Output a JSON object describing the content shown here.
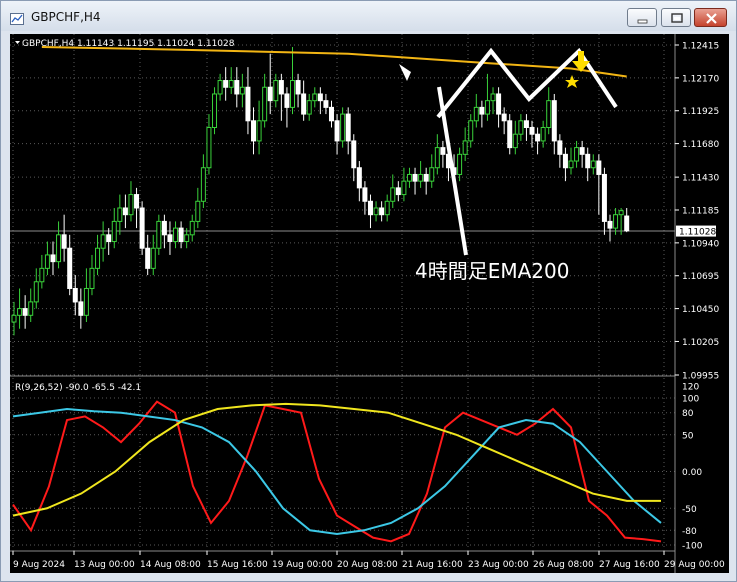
{
  "window": {
    "title": "GBPCHF,H4"
  },
  "main_panel": {
    "info_line": "GBPCHF,H4  1.11143 1.11195 1.11024 1.11028",
    "current_price": "1.11028",
    "price_ticks": [
      "1.12415",
      "1.12170",
      "1.11925",
      "1.11680",
      "1.11430",
      "1.11185",
      "1.10940",
      "1.10695",
      "1.10450",
      "1.10205",
      "1.09955"
    ],
    "annotation": "4時間足EMA200",
    "colors": {
      "ema": "#f2b514",
      "bull": "#39d23a",
      "bear": "#ffffff",
      "marker": "#ffdd00"
    }
  },
  "sub_panel": {
    "label": "R(9,26,52) -90.0 -65.5 -42.1",
    "ticks": [
      "120",
      "100",
      "80",
      "50",
      "0.00",
      "-50",
      "-80",
      "-100"
    ],
    "colors": {
      "r9": "#ff1a1a",
      "r26": "#3cc8e6",
      "r52": "#f0e61e"
    }
  },
  "date_axis": [
    "9 Aug 2024",
    "13 Aug 00:00",
    "14 Aug 08:00",
    "15 Aug 16:00",
    "19 Aug 00:00",
    "20 Aug 08:00",
    "21 Aug 16:00",
    "23 Aug 00:00",
    "26 Aug 08:00",
    "27 Aug 16:00",
    "29 Aug 00:00"
  ],
  "candles": [
    [
      1.1035,
      1.104,
      1.1025,
      1.105
    ],
    [
      1.104,
      1.1045,
      1.103,
      1.106
    ],
    [
      1.1045,
      1.104,
      1.103,
      1.1055
    ],
    [
      1.104,
      1.105,
      1.1035,
      1.106
    ],
    [
      1.105,
      1.1065,
      1.1045,
      1.1075
    ],
    [
      1.1065,
      1.1075,
      1.106,
      1.1085
    ],
    [
      1.1075,
      1.1085,
      1.107,
      1.1095
    ],
    [
      1.1085,
      1.108,
      1.107,
      1.1095
    ],
    [
      1.108,
      1.11,
      1.1075,
      1.111
    ],
    [
      1.11,
      1.109,
      1.108,
      1.1115
    ],
    [
      1.109,
      1.106,
      1.1055,
      1.11
    ],
    [
      1.106,
      1.105,
      1.104,
      1.107
    ],
    [
      1.105,
      1.104,
      1.103,
      1.106
    ],
    [
      1.104,
      1.106,
      1.1035,
      1.1075
    ],
    [
      1.106,
      1.1075,
      1.1055,
      1.1085
    ],
    [
      1.1075,
      1.109,
      1.107,
      1.11
    ],
    [
      1.109,
      1.11,
      1.108,
      1.111
    ],
    [
      1.11,
      1.1095,
      1.1085,
      1.1105
    ],
    [
      1.1095,
      1.111,
      1.109,
      1.112
    ],
    [
      1.111,
      1.112,
      1.11,
      1.113
    ],
    [
      1.112,
      1.1115,
      1.1105,
      1.113
    ],
    [
      1.1115,
      1.113,
      1.111,
      1.114
    ],
    [
      1.113,
      1.112,
      1.1105,
      1.1135
    ],
    [
      1.112,
      1.109,
      1.1085,
      1.1125
    ],
    [
      1.109,
      1.1075,
      1.107,
      1.11
    ],
    [
      1.1075,
      1.109,
      1.107,
      1.11
    ],
    [
      1.109,
      1.111,
      1.1085,
      1.1115
    ],
    [
      1.111,
      1.11,
      1.109,
      1.1115
    ],
    [
      1.11,
      1.1095,
      1.1085,
      1.111
    ],
    [
      1.1095,
      1.1105,
      1.109,
      1.111
    ],
    [
      1.1105,
      1.1095,
      1.109,
      1.111
    ],
    [
      1.1095,
      1.11,
      1.109,
      1.1105
    ],
    [
      1.11,
      1.111,
      1.1095,
      1.1115
    ],
    [
      1.111,
      1.1125,
      1.1105,
      1.1135
    ],
    [
      1.1125,
      1.115,
      1.112,
      1.116
    ],
    [
      1.115,
      1.118,
      1.1145,
      1.119
    ],
    [
      1.118,
      1.1205,
      1.1175,
      1.121
    ],
    [
      1.1205,
      1.1215,
      1.12,
      1.122
    ],
    [
      1.1215,
      1.121,
      1.12,
      1.1225
    ],
    [
      1.121,
      1.1215,
      1.1205,
      1.1225
    ],
    [
      1.1215,
      1.1205,
      1.1195,
      1.1225
    ],
    [
      1.1205,
      1.121,
      1.1195,
      1.122
    ],
    [
      1.121,
      1.1185,
      1.1175,
      1.1225
    ],
    [
      1.1185,
      1.117,
      1.116,
      1.1195
    ],
    [
      1.117,
      1.1185,
      1.116,
      1.12
    ],
    [
      1.1185,
      1.121,
      1.118,
      1.122
    ],
    [
      1.121,
      1.12,
      1.119,
      1.1235
    ],
    [
      1.12,
      1.1215,
      1.1195,
      1.122
    ],
    [
      1.1215,
      1.1205,
      1.1185,
      1.122
    ],
    [
      1.1205,
      1.1195,
      1.118,
      1.121
    ],
    [
      1.1195,
      1.1215,
      1.119,
      1.124
    ],
    [
      1.1215,
      1.1205,
      1.1195,
      1.122
    ],
    [
      1.1205,
      1.119,
      1.1185,
      1.1215
    ],
    [
      1.119,
      1.12,
      1.1185,
      1.1205
    ],
    [
      1.12,
      1.1205,
      1.1195,
      1.121
    ],
    [
      1.1205,
      1.12,
      1.119,
      1.121
    ],
    [
      1.12,
      1.1195,
      1.119,
      1.1205
    ],
    [
      1.1195,
      1.1185,
      1.118,
      1.12
    ],
    [
      1.1185,
      1.117,
      1.116,
      1.119
    ],
    [
      1.117,
      1.119,
      1.1165,
      1.1195
    ],
    [
      1.119,
      1.117,
      1.116,
      1.1195
    ],
    [
      1.117,
      1.115,
      1.114,
      1.1175
    ],
    [
      1.115,
      1.1135,
      1.1125,
      1.1155
    ],
    [
      1.1135,
      1.1125,
      1.1115,
      1.114
    ],
    [
      1.1125,
      1.1115,
      1.1105,
      1.113
    ],
    [
      1.1115,
      1.112,
      1.111,
      1.1125
    ],
    [
      1.112,
      1.1115,
      1.111,
      1.1125
    ],
    [
      1.1115,
      1.1125,
      1.111,
      1.113
    ],
    [
      1.1125,
      1.1135,
      1.112,
      1.1145
    ],
    [
      1.1135,
      1.113,
      1.1125,
      1.114
    ],
    [
      1.113,
      1.114,
      1.1125,
      1.115
    ],
    [
      1.114,
      1.1145,
      1.1135,
      1.115
    ],
    [
      1.1145,
      1.114,
      1.113,
      1.115
    ],
    [
      1.114,
      1.1145,
      1.1135,
      1.1155
    ],
    [
      1.1145,
      1.114,
      1.113,
      1.115
    ],
    [
      1.114,
      1.115,
      1.1135,
      1.116
    ],
    [
      1.115,
      1.1165,
      1.1145,
      1.1175
    ],
    [
      1.1165,
      1.116,
      1.115,
      1.117
    ],
    [
      1.116,
      1.115,
      1.114,
      1.1165
    ],
    [
      1.115,
      1.1145,
      1.1135,
      1.116
    ],
    [
      1.1145,
      1.116,
      1.114,
      1.1165
    ],
    [
      1.116,
      1.117,
      1.1155,
      1.118
    ],
    [
      1.117,
      1.1185,
      1.1165,
      1.119
    ],
    [
      1.1185,
      1.1195,
      1.118,
      1.1205
    ],
    [
      1.1195,
      1.119,
      1.118,
      1.12
    ],
    [
      1.119,
      1.12,
      1.1185,
      1.122
    ],
    [
      1.12,
      1.1205,
      1.119,
      1.121
    ],
    [
      1.1205,
      1.119,
      1.118,
      1.121
    ],
    [
      1.119,
      1.1185,
      1.1175,
      1.1195
    ],
    [
      1.1185,
      1.1165,
      1.116,
      1.119
    ],
    [
      1.1165,
      1.1175,
      1.116,
      1.1185
    ],
    [
      1.1175,
      1.1185,
      1.117,
      1.119
    ],
    [
      1.1185,
      1.118,
      1.117,
      1.119
    ],
    [
      1.118,
      1.1175,
      1.1165,
      1.1185
    ],
    [
      1.1175,
      1.117,
      1.116,
      1.118
    ],
    [
      1.117,
      1.118,
      1.1165,
      1.1185
    ],
    [
      1.118,
      1.12,
      1.1175,
      1.121
    ],
    [
      1.12,
      1.117,
      1.116,
      1.1205
    ],
    [
      1.117,
      1.116,
      1.115,
      1.1175
    ],
    [
      1.116,
      1.115,
      1.114,
      1.1165
    ],
    [
      1.115,
      1.1155,
      1.1145,
      1.1165
    ],
    [
      1.1155,
      1.1165,
      1.115,
      1.117
    ],
    [
      1.1165,
      1.116,
      1.115,
      1.117
    ],
    [
      1.116,
      1.115,
      1.114,
      1.1165
    ],
    [
      1.115,
      1.1155,
      1.1145,
      1.116
    ],
    [
      1.1155,
      1.1145,
      1.1115,
      1.116
    ],
    [
      1.1145,
      1.111,
      1.11,
      1.115
    ],
    [
      1.111,
      1.1105,
      1.1095,
      1.1115
    ],
    [
      1.1105,
      1.1115,
      1.11,
      1.112
    ],
    [
      1.1115,
      1.1118,
      1.11,
      1.112
    ],
    [
      1.1114,
      1.1103,
      1.1102,
      1.112
    ]
  ],
  "ema_points": [
    [
      5,
      1.124
    ],
    [
      30,
      1.1238
    ],
    [
      60,
      1.1235
    ],
    [
      85,
      1.1228
    ],
    [
      100,
      1.1224
    ],
    [
      110,
      1.1218
    ]
  ],
  "annotation_lines": [
    [
      [
        429,
        53
      ],
      [
        456,
        221
      ]
    ],
    [
      [
        428,
        83
      ],
      [
        481,
        17
      ],
      [
        519,
        65
      ],
      [
        569,
        17
      ],
      [
        606,
        73
      ]
    ]
  ],
  "osc_r9": [
    -45,
    -80,
    -20,
    70,
    75,
    60,
    40,
    65,
    95,
    80,
    -20,
    -70,
    -40,
    20,
    90,
    85,
    80,
    -10,
    -60,
    -75,
    -90,
    -95,
    -85,
    -30,
    60,
    80,
    70,
    60,
    50,
    65,
    85,
    60,
    -40,
    -60,
    -90,
    -92,
    -95
  ],
  "osc_r26": [
    75,
    80,
    85,
    82,
    80,
    75,
    70,
    60,
    40,
    0,
    -50,
    -80,
    -85,
    -80,
    -70,
    -50,
    -20,
    20,
    60,
    70,
    65,
    40,
    0,
    -40,
    -70
  ],
  "osc_r52": [
    -60,
    -50,
    -30,
    0,
    40,
    70,
    85,
    90,
    92,
    90,
    85,
    80,
    65,
    50,
    30,
    10,
    -10,
    -30,
    -40,
    -40
  ]
}
